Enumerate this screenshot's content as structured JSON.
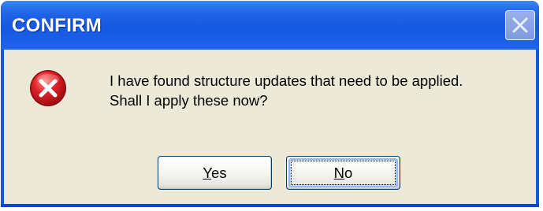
{
  "dialog": {
    "title": "CONFIRM",
    "message_line1": "I have found structure updates that need to be applied.",
    "message_line2": "Shall I apply these now?",
    "icon": "error-icon",
    "close_icon": "close-icon"
  },
  "buttons": {
    "yes": {
      "mnemonic": "Y",
      "rest": "es"
    },
    "no": {
      "mnemonic": "N",
      "rest": "o",
      "focused": true
    }
  },
  "colors": {
    "titlebar": "#1f62e6",
    "client": "#ece9d8",
    "icon_red": "#d8121b",
    "button_border": "#003c74"
  }
}
